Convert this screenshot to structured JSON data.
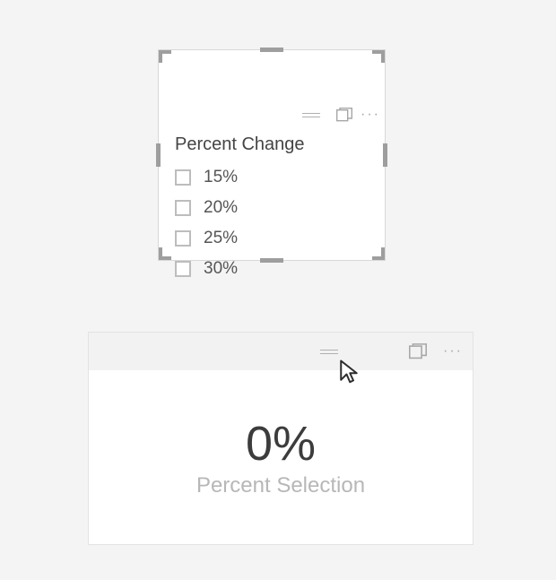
{
  "slicer": {
    "title": "Percent Change",
    "options": [
      {
        "label": "15%",
        "checked": false
      },
      {
        "label": "20%",
        "checked": false
      },
      {
        "label": "25%",
        "checked": false
      },
      {
        "label": "30%",
        "checked": false
      }
    ]
  },
  "card": {
    "value": "0%",
    "label": "Percent Selection"
  },
  "icons": {
    "drag_handle": "drag-handle-icon",
    "focus_mode": "focus-mode-icon",
    "more_options": "more-options-icon",
    "cursor": "cursor-icon"
  }
}
